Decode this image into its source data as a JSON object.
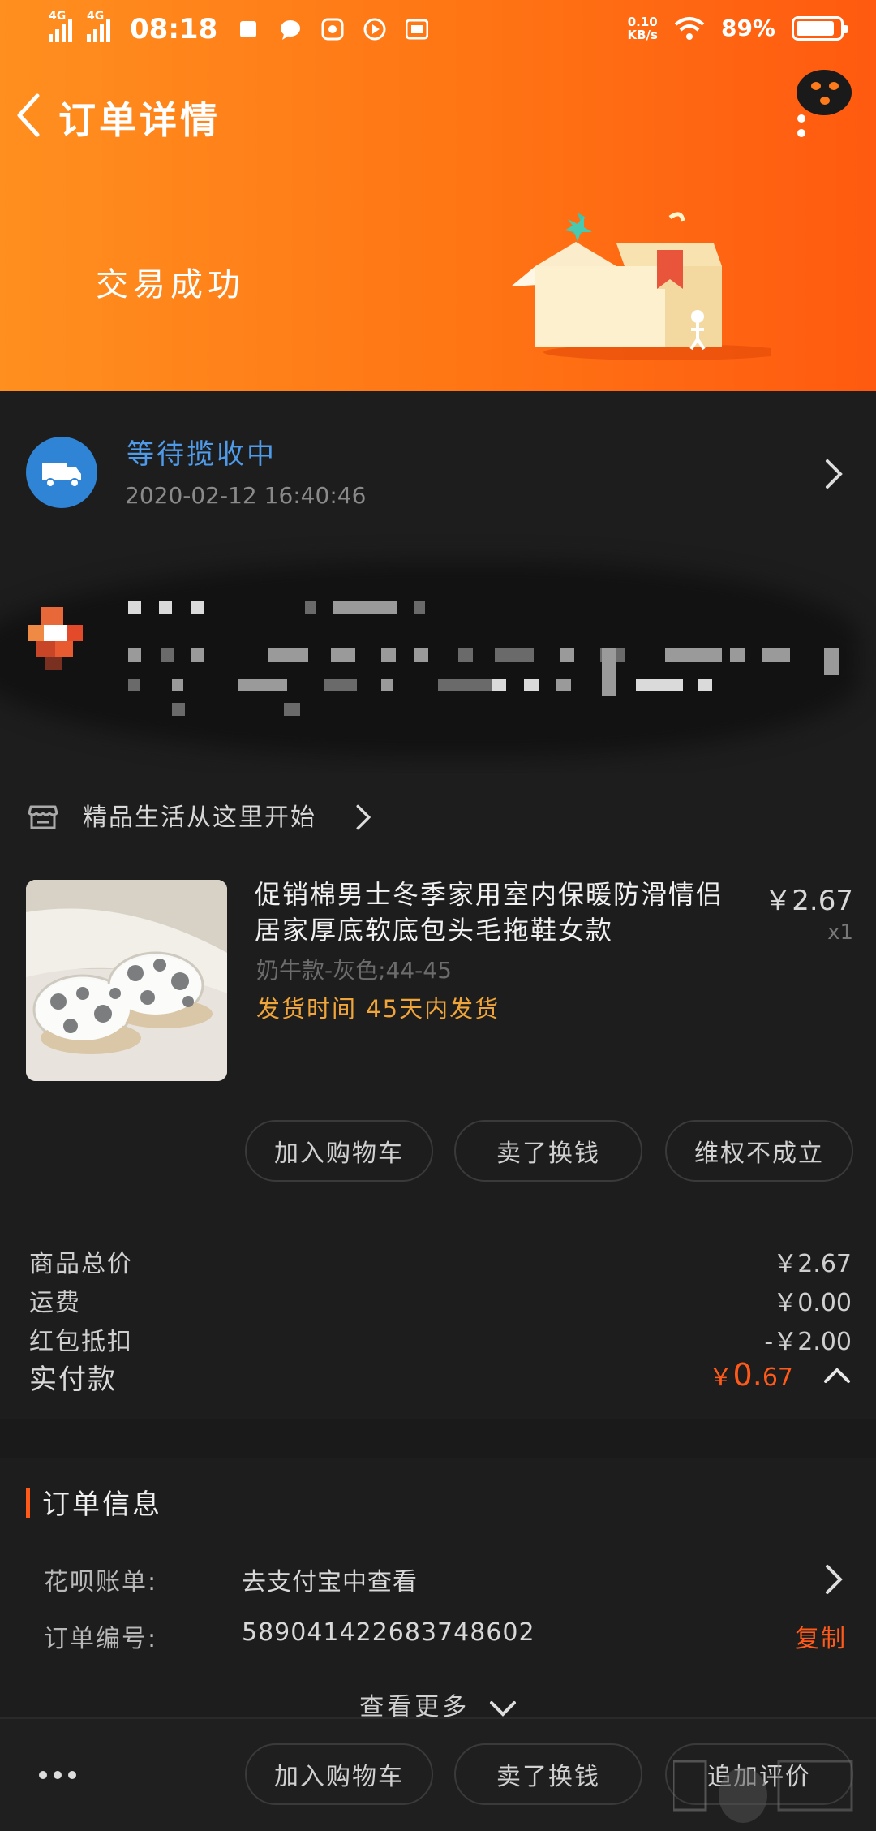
{
  "status_bar": {
    "network_1": "4G",
    "network_2": "4G",
    "time": "08:18",
    "speed_value": "0.10",
    "speed_unit": "KB/s",
    "battery_percent": "89%",
    "battery_level": 0.89
  },
  "nav": {
    "title": "订单详情"
  },
  "header": {
    "order_status": "交易成功"
  },
  "logistics": {
    "status": "等待揽收中",
    "time": "2020-02-12 16:40:46"
  },
  "shop": {
    "name": "精品生活从这里开始"
  },
  "product": {
    "title": "促销棉男士冬季家用室内保暖防滑情侣居家厚底软底包头毛拖鞋女款",
    "price": "￥2.67",
    "quantity": "x1",
    "sku": "奶牛款-灰色;44-45",
    "ship_time": "发货时间 45天内发货"
  },
  "item_actions": {
    "add_cart": "加入购物车",
    "resell": "卖了换钱",
    "rights": "维权不成立"
  },
  "summary": {
    "goods_label": "商品总价",
    "goods_value": "￥2.67",
    "shipping_label": "运费",
    "shipping_value": "￥0.00",
    "coupon_label": "红包抵扣",
    "coupon_value": "-￥2.00",
    "paid_label": "实付款",
    "paid_currency": "￥",
    "paid_int": "0.",
    "paid_dec": "67"
  },
  "order_info": {
    "title": "订单信息",
    "huabei_label": "花呗账单:",
    "huabei_value": "去支付宝中查看",
    "order_no_label": "订单编号:",
    "order_no_value": "589041422683748602",
    "copy_label": "复制",
    "more_label": "查看更多"
  },
  "bottom_bar": {
    "add_cart": "加入购物车",
    "resell": "卖了换钱",
    "review": "追加评价"
  },
  "colors": {
    "accent": "#ff5a1a",
    "header_start": "#ff8f1f",
    "header_end": "#ff5a10",
    "link_blue": "#4f9bea",
    "ship_orange": "#f0a53a"
  }
}
